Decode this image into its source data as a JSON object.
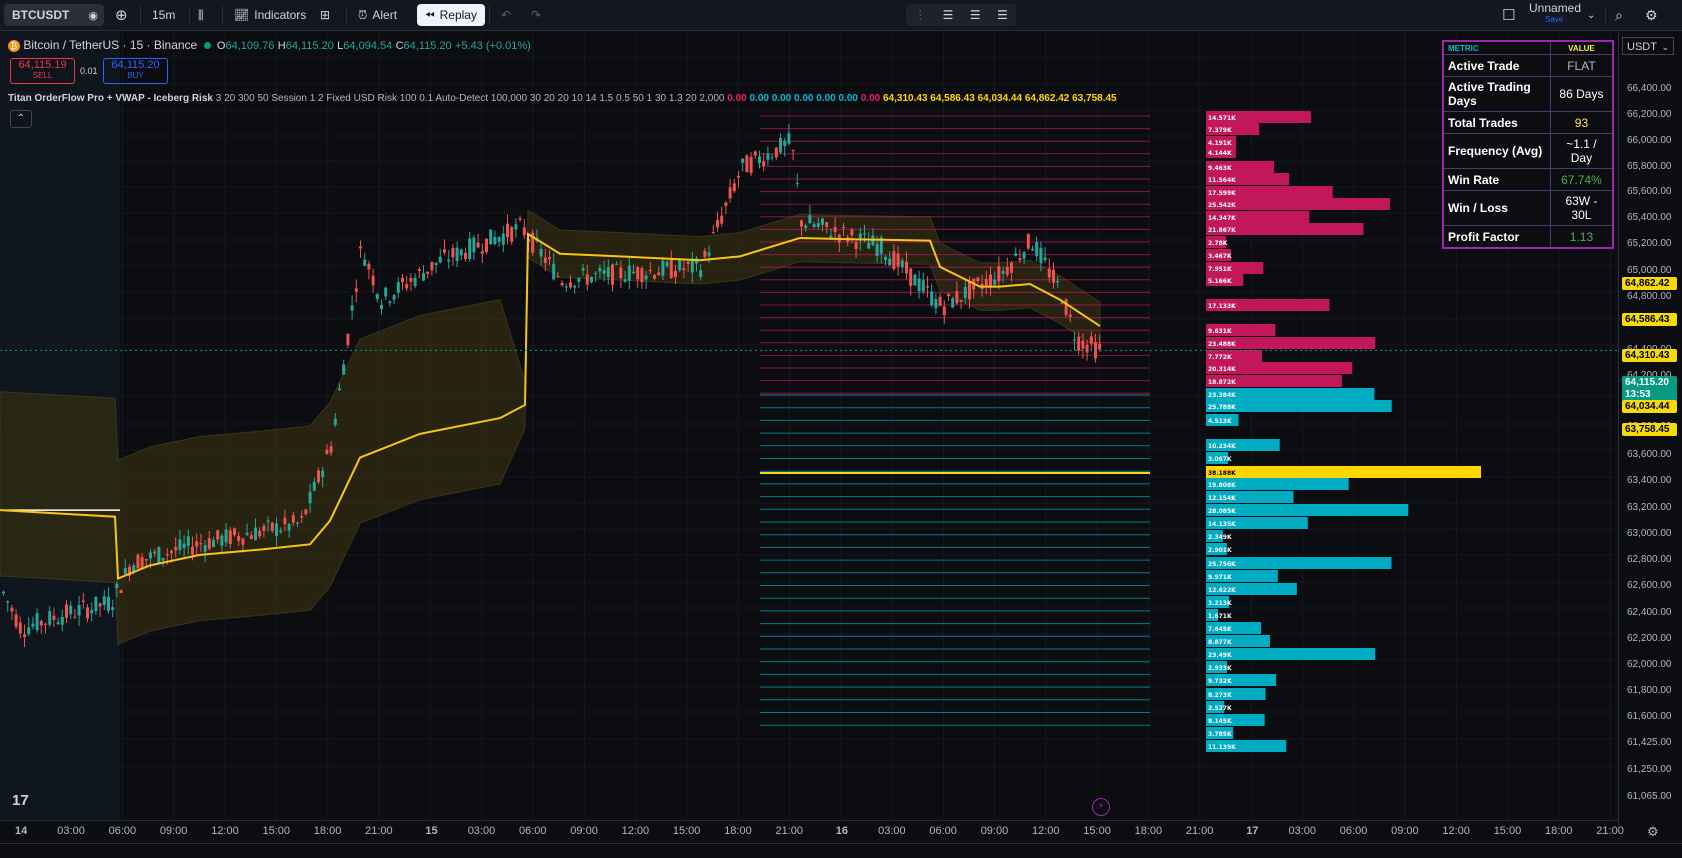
{
  "toolbar": {
    "symbol": "BTCUSDT",
    "interval": "15m",
    "indicators_label": "Indicators",
    "alert_label": "Alert",
    "replay_label": "Replay",
    "layout_name": "Unnamed",
    "layout_status": "Save"
  },
  "legend": {
    "title": "Bitcoin / TetherUS · 15 · Binance",
    "open_label": "O",
    "open": "64,109.76",
    "high_label": "H",
    "high": "64,115.20",
    "low_label": "L",
    "low": "64,094.54",
    "close_label": "C",
    "close": "64,115.20",
    "change": "+5.43 (+0.01%)"
  },
  "trade": {
    "sell_price": "64,115.19",
    "sell_label": "SELL",
    "spread": "0.01",
    "buy_price": "64,115.20",
    "buy_label": "BUY"
  },
  "indicator": {
    "name": "Titan OrderFlow Pro + VWAP - Iceberg Risk",
    "params": "3 20 300 50 Session 1 2 Fixed USD Risk 100 0.1 Auto-Detect 100,000 30 20 20 10 14 1.5 0.5 50 1 30 1.3 20 2,000",
    "values_pink": "0.00",
    "values_cyan": [
      "0.00",
      "0.00",
      "0.00",
      "0.00",
      "0.00"
    ],
    "values_pink2": "0.00",
    "values_yellow": [
      "64,310.43",
      "64,586.43",
      "64,034.44",
      "64,862.42",
      "63,758.45"
    ]
  },
  "stats": {
    "header_metric": "METRIC",
    "header_value": "VALUE",
    "rows": [
      {
        "metric": "Active Trade",
        "value": "FLAT",
        "color": "#b2b5be"
      },
      {
        "metric": "Active Trading Days",
        "value": "86 Days",
        "color": "#ffffff"
      },
      {
        "metric": "Total Trades",
        "value": "93",
        "color": "#ffeb3b"
      },
      {
        "metric": "Frequency (Avg)",
        "value": "~1.1 / Day",
        "color": "#ffffff"
      },
      {
        "metric": "Win Rate",
        "value": "67.74%",
        "color": "#4caf50"
      },
      {
        "metric": "Win / Loss",
        "value": "63W - 30L",
        "color": "#ffffff"
      },
      {
        "metric": "Profit Factor",
        "value": "1.13",
        "color": "#4caf50"
      }
    ]
  },
  "currency": "USDT",
  "price_axis": [
    "66,400.00",
    "66,200.00",
    "66,000.00",
    "65,800.00",
    "65,600.00",
    "65,400.00",
    "65,200.00",
    "65,000.00",
    "64,800.00",
    "64,600.00",
    "64,400.00",
    "64,200.00",
    "63,800.00",
    "63,600.00",
    "63,400.00",
    "63,200.00",
    "63,000.00",
    "62,800.00",
    "62,600.00",
    "62,400.00",
    "62,200.00",
    "62,000.00",
    "61,800.00",
    "61,600.00",
    "61,425.00",
    "61,250.00",
    "61,065.00"
  ],
  "price_tags": [
    {
      "text": "64,862.42",
      "bg": "#f5d90a",
      "fg": "#000000"
    },
    {
      "text": "64,586.43",
      "bg": "#f5d90a",
      "fg": "#000000"
    },
    {
      "text": "64,310.43",
      "bg": "#f5d90a",
      "fg": "#000000"
    },
    {
      "text": "64,115.20",
      "bg": "#089981",
      "fg": "#ffffff"
    },
    {
      "text": "13:53",
      "bg": "#089981",
      "fg": "#ffffff"
    },
    {
      "text": "64,034.44",
      "bg": "#f5d90a",
      "fg": "#000000"
    },
    {
      "text": "63,758.45",
      "bg": "#f5d90a",
      "fg": "#000000"
    }
  ],
  "time_axis": [
    "14",
    "03:00",
    "06:00",
    "09:00",
    "12:00",
    "15:00",
    "18:00",
    "21:00",
    "15",
    "03:00",
    "06:00",
    "09:00",
    "12:00",
    "15:00",
    "18:00",
    "21:00",
    "16",
    "03:00",
    "06:00",
    "09:00",
    "12:00",
    "15:00",
    "18:00",
    "21:00",
    "17",
    "03:00",
    "06:00",
    "09:00",
    "12:00",
    "15:00",
    "18:00",
    "21:00"
  ],
  "volume_profile": {
    "upper": [
      "14.571K",
      "7.379K",
      "4.191K",
      "4.144K",
      "9.463K",
      "11.564K",
      "17.599K",
      "25.542K",
      "14.347K",
      "21.867K",
      "2.78K",
      "3.467K",
      "7.951K",
      "5.166K",
      "17.133K",
      "9.631K",
      "23.488K",
      "7.772K",
      "20.314K",
      "18.872K"
    ],
    "lower": [
      "23.384K",
      "25.788K",
      "4.513K",
      "10.234K",
      "3.067K",
      "38.188K",
      "19.808K",
      "12.154K",
      "28.085K",
      "14.135K",
      "2.349K",
      "2.901K",
      "25.756K",
      "9.971K",
      "12.622K",
      "3.213K",
      "1.671K",
      "7.645K",
      "8.877K",
      "23.49K",
      "2.933K",
      "9.732K",
      "8.273K",
      "2.527K",
      "8.145K",
      "3.785K",
      "11.139K"
    ]
  },
  "colors": {
    "pink": "#c2185b",
    "cyan": "#00acc1",
    "gold": "#ffd600",
    "vwap": "#f5c518",
    "up": "#26a69a",
    "down": "#ef5350"
  }
}
